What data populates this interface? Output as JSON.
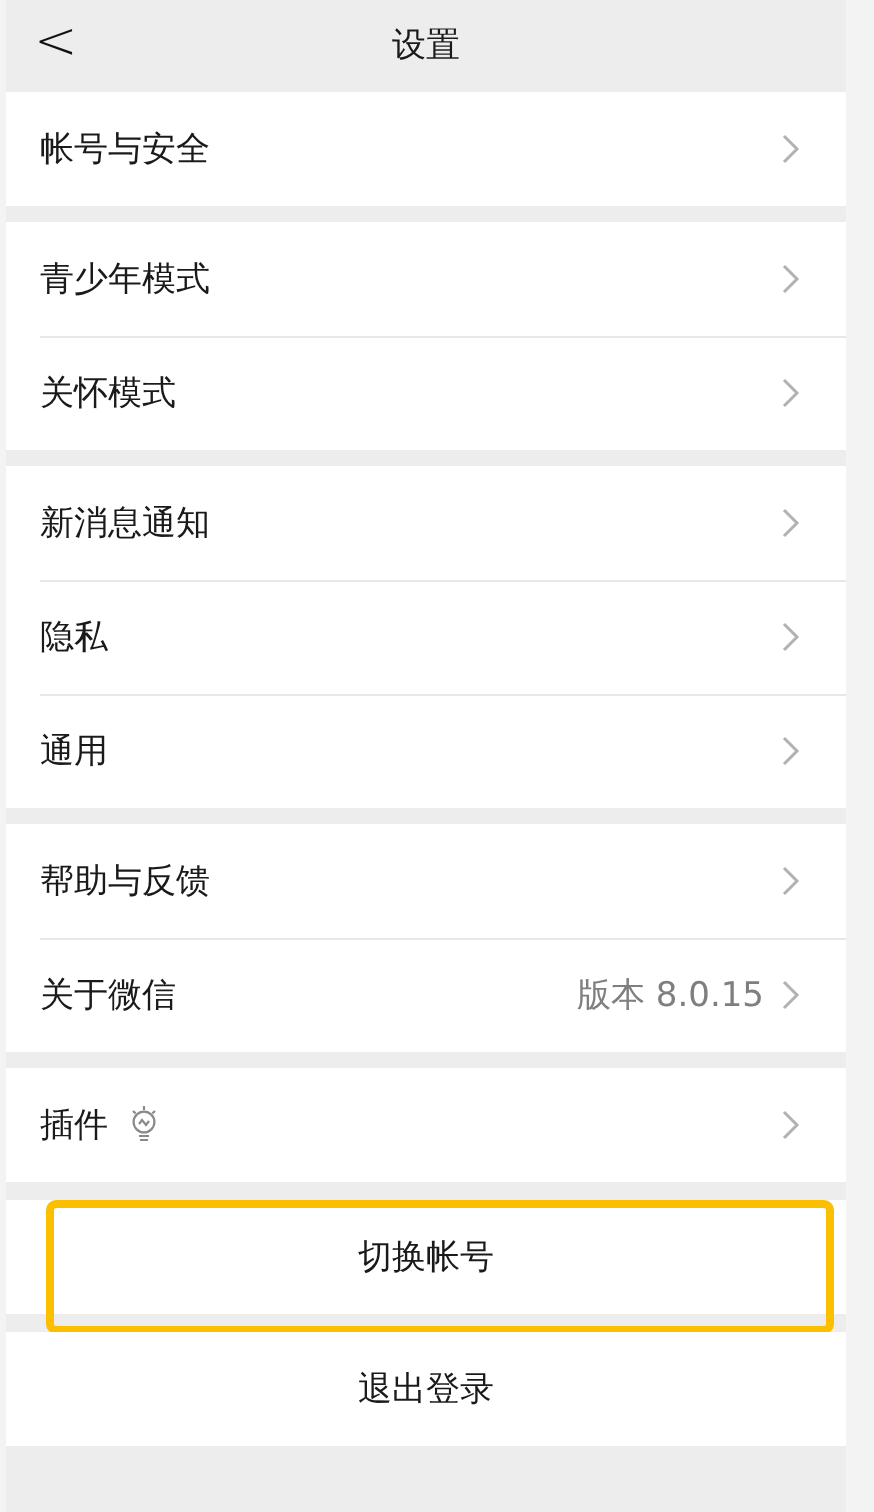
{
  "header": {
    "back": "<",
    "title": "设置"
  },
  "groups": [
    {
      "items": [
        {
          "label": "帐号与安全"
        }
      ]
    },
    {
      "items": [
        {
          "label": "青少年模式"
        },
        {
          "label": "关怀模式"
        }
      ]
    },
    {
      "items": [
        {
          "label": "新消息通知"
        },
        {
          "label": "隐私"
        },
        {
          "label": "通用"
        }
      ]
    },
    {
      "items": [
        {
          "label": "帮助与反馈"
        },
        {
          "label": "关于微信",
          "value": "版本 8.0.15"
        }
      ]
    },
    {
      "items": [
        {
          "label": "插件",
          "kind": "with-icon"
        }
      ]
    }
  ],
  "actions": [
    {
      "label": "切换帐号",
      "highlighted": true
    },
    {
      "label": "退出登录",
      "highlighted": false
    }
  ]
}
